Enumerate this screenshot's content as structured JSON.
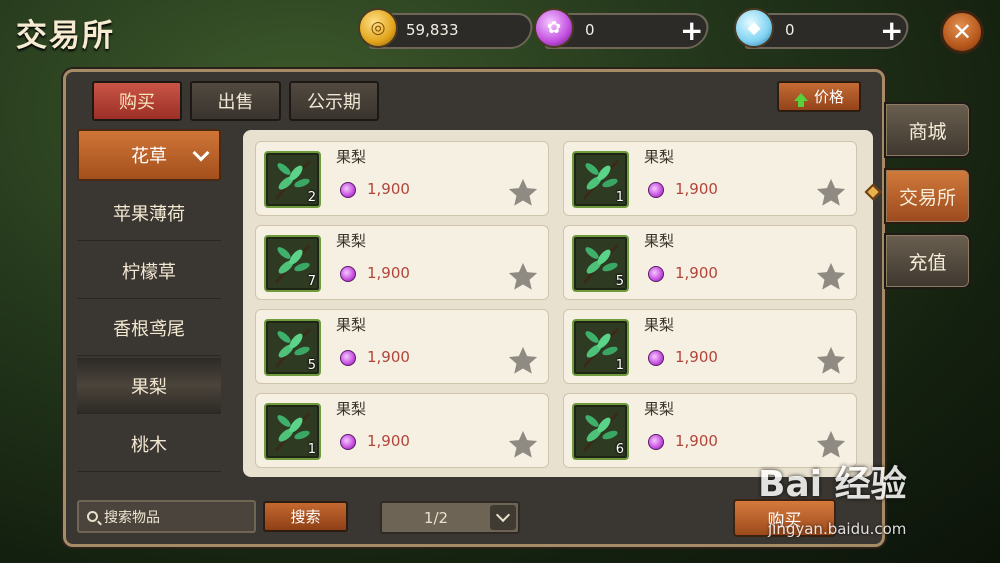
{
  "header": {
    "title": "交易所",
    "close_icon": "close-icon"
  },
  "currencies": [
    {
      "icon": "gold-coin-icon",
      "value": "59,833",
      "has_plus": false
    },
    {
      "icon": "purple-gem-icon",
      "value": "0",
      "has_plus": true
    },
    {
      "icon": "diamond-icon",
      "value": "0",
      "has_plus": true
    }
  ],
  "tabs": [
    {
      "label": "购买",
      "active": true
    },
    {
      "label": "出售",
      "active": false
    },
    {
      "label": "公示期",
      "active": false
    }
  ],
  "sort": {
    "label": "价格",
    "direction": "up"
  },
  "categories": [
    {
      "label": "花草",
      "selected": true
    },
    {
      "label": "苹果薄荷"
    },
    {
      "label": "柠檬草"
    },
    {
      "label": "香根鸢尾"
    },
    {
      "label": "果梨",
      "highlighted": true
    },
    {
      "label": "桃木"
    }
  ],
  "items": [
    {
      "name": "果梨",
      "price": "1,900",
      "count": "2"
    },
    {
      "name": "果梨",
      "price": "1,900",
      "count": "1"
    },
    {
      "name": "果梨",
      "price": "1,900",
      "count": "7"
    },
    {
      "name": "果梨",
      "price": "1,900",
      "count": "5"
    },
    {
      "name": "果梨",
      "price": "1,900",
      "count": "5"
    },
    {
      "name": "果梨",
      "price": "1,900",
      "count": "1"
    },
    {
      "name": "果梨",
      "price": "1,900",
      "count": "1"
    },
    {
      "name": "果梨",
      "price": "1,900",
      "count": "6"
    }
  ],
  "search": {
    "placeholder": "搜索物品",
    "button": "搜索"
  },
  "pager": {
    "value": "1/2"
  },
  "buy_button": "购买",
  "side_nav": [
    {
      "label": "商城",
      "selected": false
    },
    {
      "label": "交易所",
      "selected": true
    },
    {
      "label": "充值",
      "selected": false
    }
  ],
  "watermark": {
    "text": "Bai 经验",
    "url_text": "jingyan.baidu.com"
  },
  "colors": {
    "accent_orange": "#c46b35",
    "tab_active_red": "#b13e33",
    "price_red": "#b3443a",
    "card_bg": "#f6f0e2"
  }
}
